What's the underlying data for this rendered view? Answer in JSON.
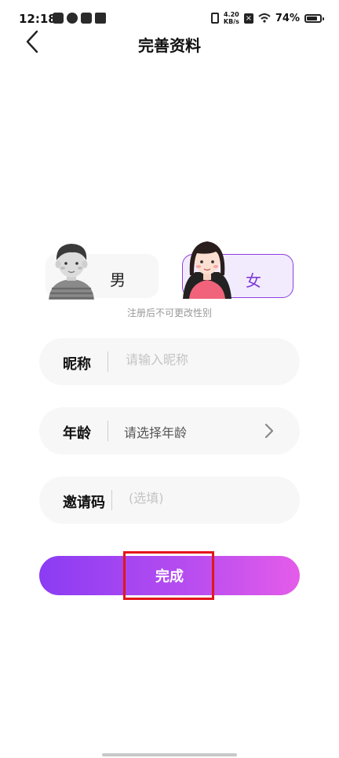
{
  "status_bar": {
    "time": "12:18",
    "net_speed_top": "4.20",
    "net_speed_bottom": "KB/s",
    "battery_percent": "74%",
    "battery_level": 0.74
  },
  "header": {
    "title": "完善资料",
    "back_icon": "chevron-left-icon"
  },
  "gender": {
    "male_label": "男",
    "female_label": "女",
    "selected": "female",
    "hint": "注册后不可更改性别"
  },
  "form": {
    "nickname": {
      "label": "昵称",
      "placeholder": "请输入昵称",
      "value": ""
    },
    "age": {
      "label": "年龄",
      "value": "请选择年龄",
      "icon": "chevron-right-icon"
    },
    "invite_code": {
      "label": "邀请码",
      "placeholder": "(选填)",
      "value": ""
    }
  },
  "submit": {
    "label": "完成"
  },
  "colors": {
    "accent": "#8c3ee0",
    "gradient_start": "#8b3cf3",
    "gradient_end": "#e45ce9",
    "highlight": "#e2161a"
  }
}
